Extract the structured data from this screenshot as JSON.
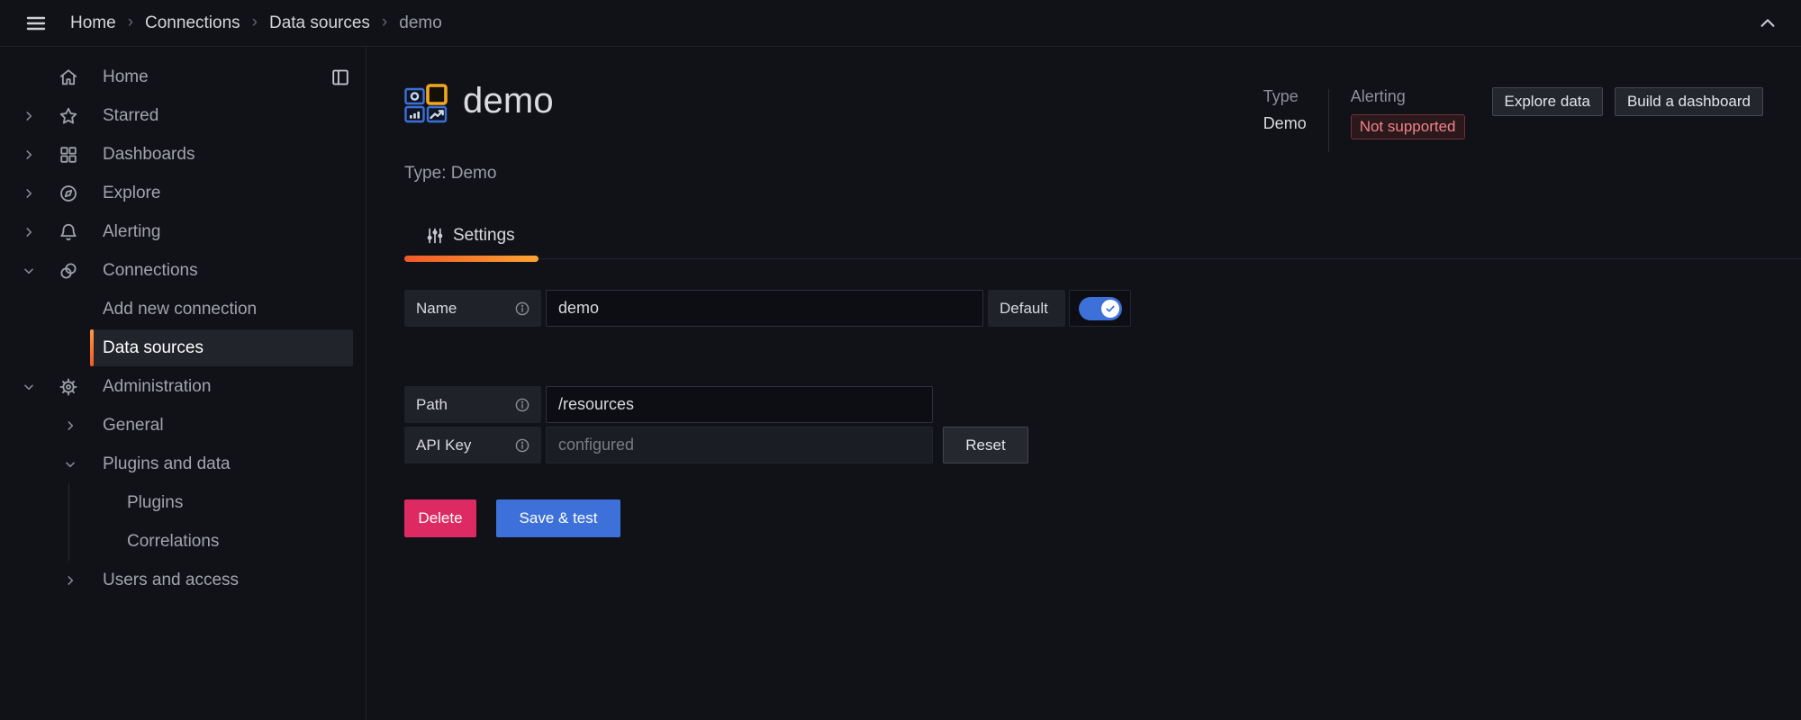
{
  "topbar": {
    "breadcrumb": [
      {
        "label": "Home"
      },
      {
        "label": "Connections"
      },
      {
        "label": "Data sources"
      },
      {
        "label": "demo"
      }
    ],
    "separator": "›"
  },
  "sidebar": {
    "items": [
      {
        "label": "Home"
      },
      {
        "label": "Starred"
      },
      {
        "label": "Dashboards"
      },
      {
        "label": "Explore"
      },
      {
        "label": "Alerting"
      },
      {
        "label": "Connections"
      },
      {
        "label": "Add new connection"
      },
      {
        "label": "Data sources"
      },
      {
        "label": "Administration"
      },
      {
        "label": "General"
      },
      {
        "label": "Plugins and data"
      },
      {
        "label": "Plugins"
      },
      {
        "label": "Correlations"
      },
      {
        "label": "Users and access"
      }
    ]
  },
  "header": {
    "title": "demo",
    "subtitle": "Type: Demo",
    "type_label": "Type",
    "type_value": "Demo",
    "alerting_label": "Alerting",
    "alerting_badge": "Not supported",
    "explore_button": "Explore data",
    "build_button": "Build a dashboard"
  },
  "tabs": {
    "settings_label": "Settings"
  },
  "form": {
    "name_label": "Name",
    "name_value": "demo",
    "default_label": "Default",
    "default_on": true,
    "path_label": "Path",
    "path_value": "/resources",
    "api_key_label": "API Key",
    "api_key_placeholder": "configured",
    "reset_button": "Reset",
    "delete_button": "Delete",
    "save_button": "Save & test"
  },
  "colors": {
    "accent_orange_start": "#f05a28",
    "accent_orange_end": "#fba333",
    "primary_blue": "#3d71d9",
    "destructive_red": "#dd2a63",
    "badge_red_text": "#f0838d",
    "background": "#111218"
  }
}
